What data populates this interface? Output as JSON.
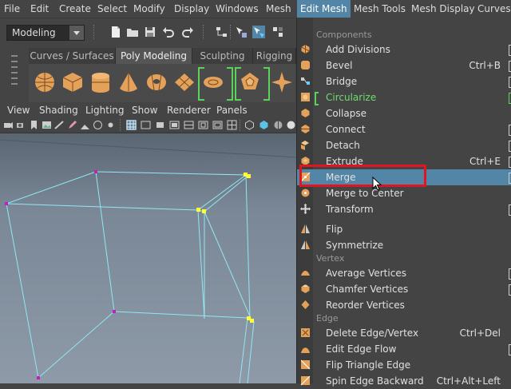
{
  "menubar": {
    "items": [
      "File",
      "Edit",
      "Create",
      "Select",
      "Modify",
      "Display",
      "Windows",
      "Mesh",
      "Edit Mesh",
      "Mesh Tools",
      "Mesh Display",
      "Curves"
    ],
    "active_index": 8
  },
  "toolbar": {
    "mode_value": "Modeling"
  },
  "shelf": {
    "tabs": [
      "Curves / Surfaces",
      "Poly Modeling",
      "Sculpting",
      "Rigging"
    ],
    "active_tab": "Poly Modeling"
  },
  "viewport_menu": {
    "items": [
      "View",
      "Shading",
      "Lighting",
      "Show",
      "Renderer",
      "Panels"
    ]
  },
  "edit_mesh_menu": {
    "sections": {
      "components": "Components",
      "vertex": "Vertex",
      "edge": "Edge"
    },
    "items": [
      {
        "label": "Add Divisions",
        "shortcut": "",
        "options": true,
        "icon": "add-divisions-icon"
      },
      {
        "label": "Bevel",
        "shortcut": "Ctrl+B",
        "options": true,
        "icon": "bevel-icon"
      },
      {
        "label": "Bridge",
        "shortcut": "",
        "options": true,
        "icon": "bridge-icon"
      },
      {
        "label": "Circularize",
        "shortcut": "",
        "options": true,
        "icon": "circularize-icon"
      },
      {
        "label": "Collapse",
        "shortcut": "",
        "options": false,
        "icon": "collapse-icon"
      },
      {
        "label": "Connect",
        "shortcut": "",
        "options": true,
        "icon": "connect-icon"
      },
      {
        "label": "Detach",
        "shortcut": "",
        "options": true,
        "icon": "detach-icon"
      },
      {
        "label": "Extrude",
        "shortcut": "Ctrl+E",
        "options": true,
        "icon": "extrude-icon"
      },
      {
        "label": "Merge",
        "shortcut": "",
        "options": true,
        "icon": "merge-icon"
      },
      {
        "label": "Merge to Center",
        "shortcut": "",
        "options": false,
        "icon": "merge-to-center-icon"
      },
      {
        "label": "Transform",
        "shortcut": "",
        "options": true,
        "icon": "transform-icon"
      },
      {
        "label": "Flip",
        "shortcut": "",
        "options": false,
        "icon": "flip-icon"
      },
      {
        "label": "Symmetrize",
        "shortcut": "",
        "options": false,
        "icon": "symmetrize-icon"
      },
      {
        "label": "Average Vertices",
        "shortcut": "",
        "options": true,
        "icon": "average-vertices-icon"
      },
      {
        "label": "Chamfer Vertices",
        "shortcut": "",
        "options": true,
        "icon": "chamfer-vertices-icon"
      },
      {
        "label": "Reorder Vertices",
        "shortcut": "",
        "options": false,
        "icon": "reorder-vertices-icon"
      },
      {
        "label": "Delete Edge/Vertex",
        "shortcut": "Ctrl+Del",
        "options": false,
        "icon": "delete-edge-icon"
      },
      {
        "label": "Edit Edge Flow",
        "shortcut": "",
        "options": true,
        "icon": "edit-edge-flow-icon"
      },
      {
        "label": "Flip Triangle Edge",
        "shortcut": "",
        "options": false,
        "icon": "flip-triangle-edge-icon"
      },
      {
        "label": "Spin Edge Backward",
        "shortcut": "Ctrl+Alt+Left",
        "options": false,
        "icon": "spin-edge-backward-icon"
      }
    ]
  },
  "colors": {
    "menu_highlight": "#5285a6",
    "annotation_red": "#e0151f",
    "option_green": "#6fdc6f",
    "wireframe": "#8fe8f2"
  }
}
